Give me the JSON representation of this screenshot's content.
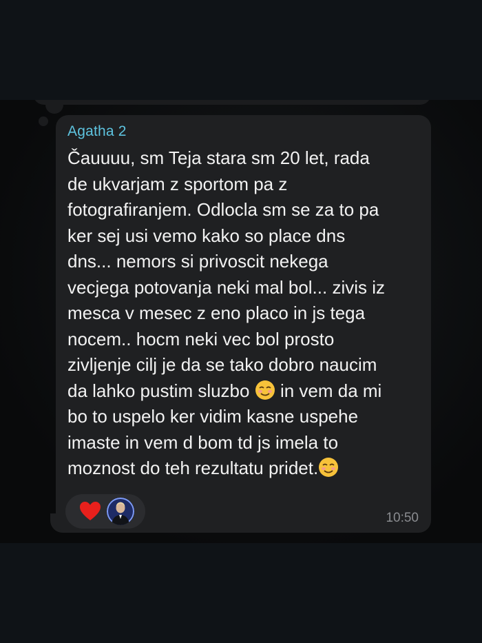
{
  "message": {
    "sender": "Agatha 2",
    "lines": [
      "Čauuuu, sm Teja stara sm 20 let, rada",
      "de ukvarjam z sportom pa z",
      "fotografiranjem. Odlocla sm se za to pa",
      "ker sej usi vemo kako so place dns",
      "dns... nemors si privoscit nekega",
      "vecjega potovanja neki mal bol... zivis iz",
      "mesca v mesec z eno placo in js tega",
      "nocem.. hocm neki vec bol prosto",
      "zivljenje cilj je da se tako dobro naucim",
      "da lahko pustim sluzbo",
      "in vem da mi",
      "bo to uspelo ker vidim kasne uspehe",
      "imaste in vem d bom td js imela to",
      "moznost do teh rezultatu pridet."
    ],
    "emoji": "smiling-face-icon",
    "time": "10:50",
    "reactions": [
      "heart-icon",
      "reactor-avatar"
    ]
  },
  "colors": {
    "background": "#0f1317",
    "bubble": "#1f2022",
    "sender": "#5ec4e0",
    "text": "#f2f2f2",
    "time": "#8a8c90",
    "heart": "#e8201c"
  }
}
